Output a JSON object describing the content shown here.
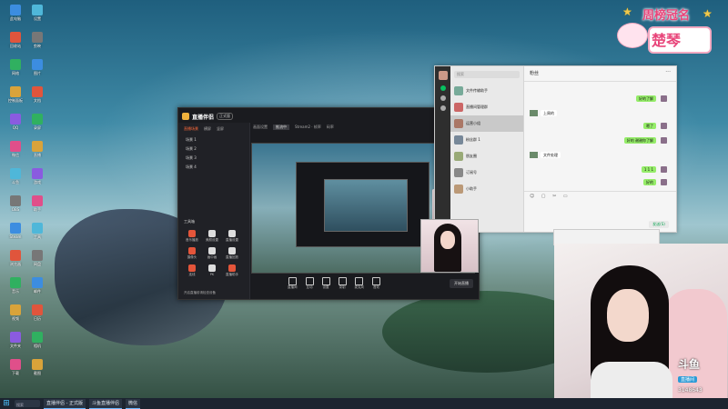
{
  "badge": {
    "title": "周榜冠名",
    "name": "楚琴"
  },
  "stream_app": {
    "brand": "直播伴侣",
    "version": "正式版",
    "tabs": [
      "直播场景",
      "横屏",
      "竖屏"
    ],
    "scenes": [
      "场景 1",
      "场景 2",
      "场景 3",
      "场景 4"
    ],
    "top_bar": [
      "画面设置",
      "推流中",
      "Stream2 · 帧率",
      "码率"
    ],
    "section_label": "工具箱",
    "tools": [
      "音乐播放",
      "美颜设置",
      "直播设置",
      "摄像头",
      "画中画",
      "直播回放",
      "连线",
      "PK",
      "直播助手"
    ],
    "footer_note": "开启直播前请检查设备",
    "bottom_tools": [
      "直播间",
      "互动",
      "设置",
      "录制",
      "麦克风",
      "音效"
    ],
    "go_live_label": "开始直播"
  },
  "chat": {
    "search_placeholder": "搜索",
    "conversations": [
      "文件传输助手",
      "直播间管理群",
      "运营小组",
      "粉丝群 1",
      "朋友圈",
      "订阅号",
      "小助手"
    ],
    "header_title": "粉丝",
    "messages": [
      {
        "from": "me",
        "text": "好的了解"
      },
      {
        "from": "other",
        "text": "上周的"
      },
      {
        "from": "me",
        "text": "嗯了"
      },
      {
        "from": "me",
        "text": "好的 谢谢你了解"
      },
      {
        "from": "other",
        "text": "文件处理"
      },
      {
        "from": "me",
        "text": "1 1 1"
      },
      {
        "from": "me",
        "text": "好的"
      }
    ],
    "send_label": "发送(S)"
  },
  "douyu": {
    "logo": "斗鱼",
    "sub": "直播间",
    "room_id": "3148643"
  },
  "taskbar": {
    "search": "搜索",
    "tasks": [
      "直播伴侣 - 正式版",
      "斗鱼直播伴侣",
      "微信"
    ]
  },
  "desktop_icons": [
    "此电脑",
    "回收站",
    "网络",
    "控制面板",
    "QQ",
    "微信",
    "斗鱼",
    "OBS",
    "Steam",
    "浏览器",
    "音乐",
    "视频",
    "文件夹",
    "下载",
    "设置",
    "剪映",
    "图片",
    "文档",
    "录屏",
    "直播",
    "游戏",
    "助手",
    "工具",
    "网盘",
    "邮件",
    "日历",
    "相机",
    "截图"
  ],
  "colors": {
    "accent_orange": "#ff6a3a",
    "wechat_green": "#95ec69",
    "badge_pink": "#e8457a",
    "douyu_blue": "#2c9bd6"
  }
}
